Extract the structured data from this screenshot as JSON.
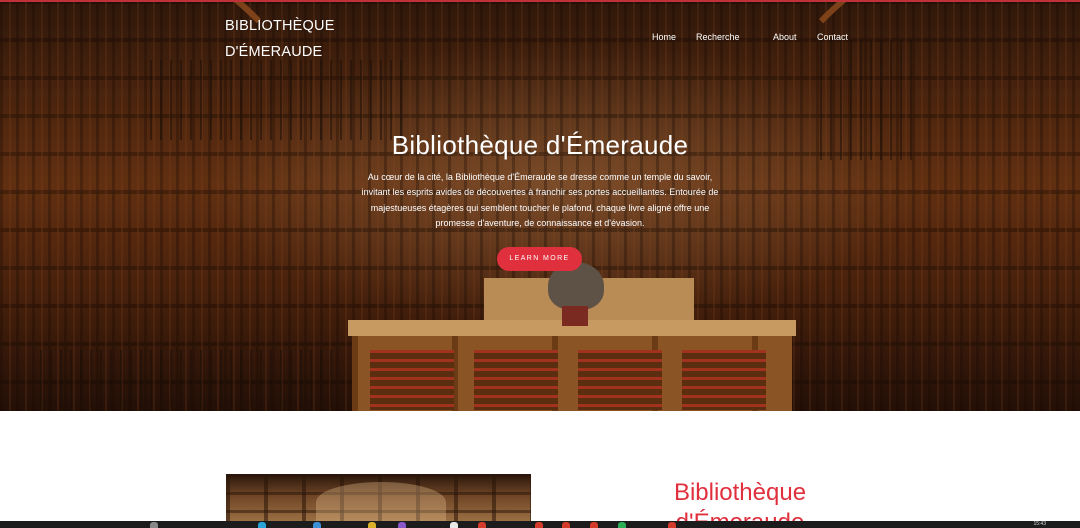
{
  "brand": {
    "line1": "BIBLIOTHÈQUE",
    "line2": "D'ÉMERAUDE"
  },
  "nav": {
    "home": "Home",
    "recherche": "Recherche",
    "about": "About",
    "contact": "Contact"
  },
  "hero": {
    "title": "Bibliothèque d'Émeraude",
    "text": "Au cœur de la cité, la Bibliothèque d'Émeraude se dresse comme un temple du savoir, invitant les esprits avides de découvertes à franchir ses portes accueillantes. Entourée de majestueuses étagères qui semblent toucher le plafond, chaque livre aligné offre une promesse d'aventure, de connaissance et d'évasion.",
    "cta": "LEARN MORE"
  },
  "section": {
    "title": "Bibliothèque d'Émeraude"
  },
  "taskbar": {
    "clock": "15:43"
  },
  "colors": {
    "accent": "#e0303d",
    "topline": "#c0313a"
  }
}
